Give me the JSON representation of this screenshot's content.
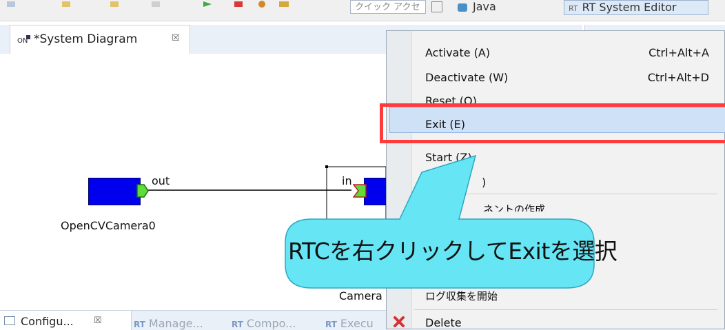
{
  "toolbar": {
    "quick_access": "クイック アクセス",
    "perspective_java": "Java",
    "perspective_rtse": "RT System Editor"
  },
  "editor": {
    "tab_title": "*System Diagram",
    "tab_close": "☒",
    "components": [
      {
        "name": "OpenCVCamera0",
        "port_label": "out"
      },
      {
        "name": "Camera",
        "port_label": "in"
      }
    ]
  },
  "bottom_tabs": [
    {
      "label": "Configu...",
      "close": "☒"
    },
    {
      "label": "Manage..."
    },
    {
      "label": "Compo..."
    },
    {
      "label": "Execu"
    }
  ],
  "context_menu": {
    "items": [
      {
        "label": "Activate (A)",
        "shortcut": "Ctrl+Alt+A"
      },
      {
        "label": "Deactivate (W)",
        "shortcut": "Ctrl+Alt+D"
      },
      {
        "label": "Reset (O)",
        "shortcut": ""
      },
      {
        "label": "Exit (E)",
        "shortcut": ""
      },
      {
        "label": "Start (Z)",
        "shortcut": ""
      },
      {
        "label": ")",
        "shortcut": ""
      },
      {
        "label": "ネントの作成",
        "shortcut": ""
      },
      {
        "label": "ログ収集を開始",
        "shortcut": ""
      },
      {
        "label": "Delete",
        "shortcut": ""
      }
    ],
    "selected_index": 3
  },
  "callout": {
    "text": "RTCを右クリックしてExitを選択"
  },
  "colors": {
    "highlight": "#ff3b3b",
    "callout_fill": "#66e5f5",
    "component_fill": "#0000ee",
    "port_fill": "#5ddc3a"
  }
}
